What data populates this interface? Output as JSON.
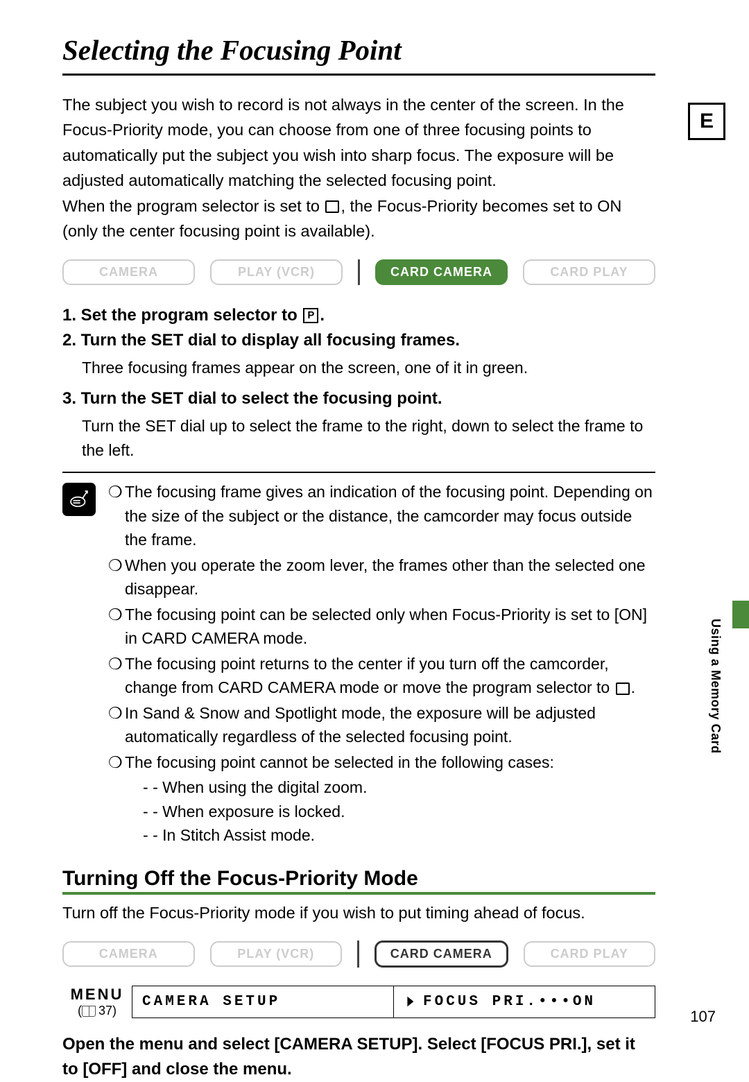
{
  "lang_tag": "E",
  "side_label": "Using a Memory Card",
  "page_number": "107",
  "title": "Selecting the Focusing Point",
  "intro_p1": "The subject you wish to record is not always in the center of the screen. In the Focus-Priority mode, you can choose from one of three focusing points to automatically put the subject you wish into sharp focus. The exposure will be adjusted automatically matching the selected focusing point.",
  "intro_p2a": "When the program selector is set to ",
  "intro_p2b": ", the Focus-Priority becomes set to ON (only the center focusing point is available).",
  "modes": {
    "a": "CAMERA",
    "b": "PLAY (VCR)",
    "c": "CARD CAMERA",
    "d": "CARD PLAY"
  },
  "step1a": "1. Set the program selector to ",
  "step1b": ".",
  "step2": "2. Turn the SET dial to display all focusing frames.",
  "step2_sub": "Three focusing frames appear on the screen, one of it in green.",
  "step3": "3. Turn the SET dial to select the focusing point.",
  "step3_sub": "Turn the SET dial up to select the frame to the right, down to select the frame to the left.",
  "notes": {
    "n1": "The focusing frame gives an indication of the focusing point. Depending on the size of the subject or the distance, the camcorder may focus outside the frame.",
    "n2": "When you operate the zoom lever, the frames other than the selected one disappear.",
    "n3": "The focusing point can be selected only when Focus-Priority is set to [ON] in CARD CAMERA mode.",
    "n4a": "The focusing point returns to the center if you turn off the camcorder, change from CARD CAMERA mode or move the program selector to ",
    "n4b": ".",
    "n5": "In Sand & Snow and Spotlight mode, the exposure will be adjusted automatically regardless of the selected focusing point.",
    "n6": "The focusing point cannot be selected in the following cases:",
    "s1": "When using the digital zoom.",
    "s2": "When exposure is locked.",
    "s3": "In Stitch Assist mode."
  },
  "section2_title": "Turning Off the Focus-Priority Mode",
  "section2_intro": "Turn off the Focus-Priority mode if you wish to put timing ahead of focus.",
  "menu": {
    "label": "MENU",
    "page": "37",
    "cell1": "CAMERA SETUP",
    "cell2": "FOCUS PRI.•••ON"
  },
  "final_instr": "Open the menu and select [CAMERA SETUP]. Select [FOCUS PRI.], set it to [OFF] and close the menu."
}
